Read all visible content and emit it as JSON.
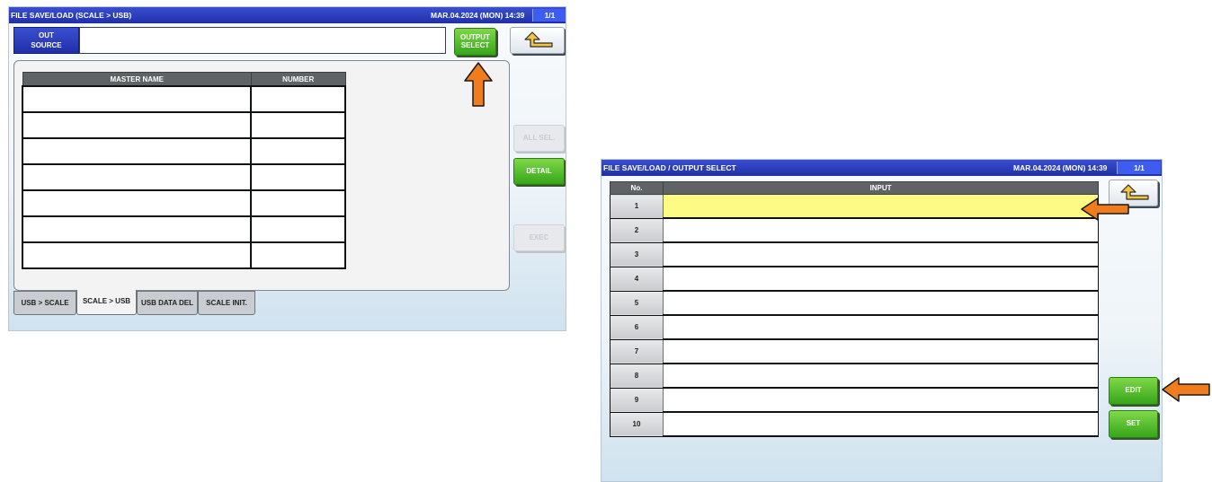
{
  "screen1": {
    "title": "FILE SAVE/LOAD (SCALE > USB)",
    "datetime": "MAR.04.2024 (MON)  14:39",
    "page": "1/1",
    "out_source_label_line1": "OUT",
    "out_source_label_line2": "SOURCE",
    "out_source_value": "",
    "output_select_line1": "OUTPUT",
    "output_select_line2": "SELECT",
    "table_headers": [
      "MASTER NAME",
      "NUMBER"
    ],
    "rows": [
      [
        "",
        ""
      ],
      [
        "",
        ""
      ],
      [
        "",
        ""
      ],
      [
        "",
        ""
      ],
      [
        "",
        ""
      ],
      [
        "",
        ""
      ],
      [
        "",
        ""
      ]
    ],
    "buttons": {
      "all_sel": "ALL SEL.",
      "detail": "DETAIL",
      "exec": "EXEC"
    },
    "tabs": [
      "USB > SCALE",
      "SCALE > USB",
      "USB DATA DEL",
      "SCALE INIT."
    ],
    "active_tab": "SCALE > USB"
  },
  "screen2": {
    "title": "FILE SAVE/LOAD / OUTPUT SELECT",
    "datetime": "MAR.04.2024 (MON)  14:39",
    "page": "1/1",
    "headers": [
      "No.",
      "INPUT"
    ],
    "rows": [
      {
        "no": "1",
        "input": ""
      },
      {
        "no": "2",
        "input": ""
      },
      {
        "no": "3",
        "input": ""
      },
      {
        "no": "4",
        "input": ""
      },
      {
        "no": "5",
        "input": ""
      },
      {
        "no": "6",
        "input": ""
      },
      {
        "no": "7",
        "input": ""
      },
      {
        "no": "8",
        "input": ""
      },
      {
        "no": "9",
        "input": ""
      },
      {
        "no": "10",
        "input": ""
      }
    ],
    "selected_row": "1",
    "buttons": {
      "edit": "EDIT",
      "set": "SET"
    }
  },
  "icons": {
    "back": "back-arrow-icon",
    "pointer": "orange-arrow-icon"
  },
  "colors": {
    "accent_blue": "#2233b8",
    "green": "#4cbf24",
    "highlight": "#fdfb83",
    "pointer": "#f07c1e"
  }
}
